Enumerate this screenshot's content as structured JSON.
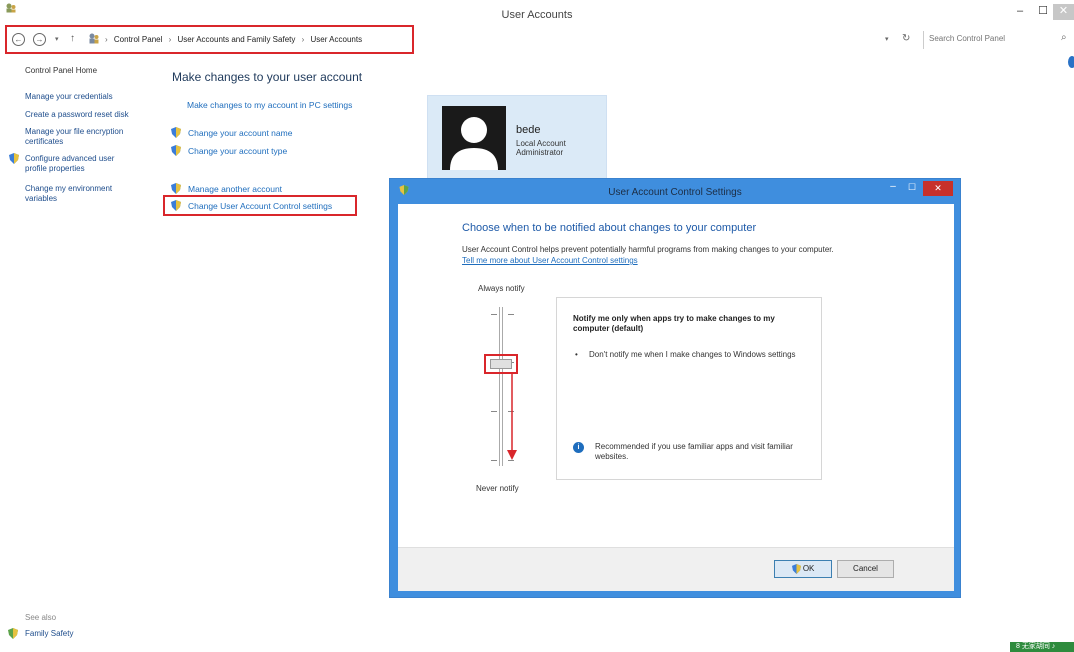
{
  "window": {
    "title": "User Accounts",
    "min_label": "–",
    "max_label": "☐",
    "close_label": "✕"
  },
  "address": {
    "breadcrumbs": [
      "Control Panel",
      "User Accounts and Family Safety",
      "User Accounts"
    ],
    "separator": "›",
    "search_placeholder": "Search Control Panel"
  },
  "leftnav": {
    "home": "Control Panel Home",
    "items": [
      "Manage your credentials",
      "Create a password reset disk",
      "Manage your file encryption certificates",
      "Configure advanced user profile properties",
      "Change my environment variables"
    ],
    "see_also": "See also",
    "family_safety": "Family Safety"
  },
  "main": {
    "heading": "Make changes to your user account",
    "pc_settings_link": "Make changes to my account in PC settings",
    "change_name": "Change your account name",
    "change_type": "Change your account type",
    "manage_another": "Manage another account",
    "uac_settings": "Change User Account Control settings"
  },
  "account": {
    "name": "bede",
    "type": "Local Account",
    "role": "Administrator"
  },
  "dialog": {
    "title": "User Account Control Settings",
    "close_label": "✕",
    "heading": "Choose when to be notified about changes to your computer",
    "description": "User Account Control helps prevent potentially harmful programs from making changes to your computer.",
    "link": "Tell me more about User Account Control settings",
    "always_notify": "Always notify",
    "never_notify": "Never notify",
    "slider_level": 2,
    "slider_levels": 4,
    "info_title": "Notify me only when apps try to make changes to my computer (default)",
    "info_bullet": "Don't notify me when I make changes to Windows settings",
    "info_recommended": "Recommended if you use familiar apps and visit familiar websites.",
    "ok_label": "OK",
    "cancel_label": "Cancel"
  },
  "tray": {
    "label": "8 无家胡同 ♪"
  },
  "colors": {
    "accent_blue": "#3f8ede",
    "link_blue": "#1e6dbd",
    "highlight_red": "#d9262b",
    "card_bg": "#dbeaf7"
  }
}
